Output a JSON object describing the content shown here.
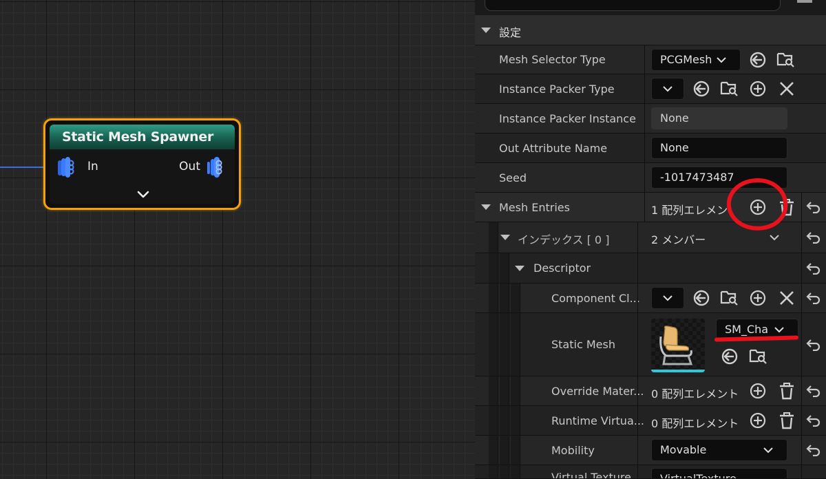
{
  "node": {
    "title": "Static Mesh Spawner",
    "input_pin": "In",
    "output_pin": "Out"
  },
  "panel": {
    "section_title": "設定",
    "mesh_selector_type": {
      "label": "Mesh Selector Type",
      "value": "PCGMesh"
    },
    "instance_packer_type": {
      "label": "Instance Packer Type",
      "value": ""
    },
    "instance_packer_instance": {
      "label": "Instance Packer Instance",
      "value": "None"
    },
    "out_attribute_name": {
      "label": "Out Attribute Name",
      "value": "None"
    },
    "seed": {
      "label": "Seed",
      "value": "-1017473487"
    },
    "mesh_entries": {
      "label": "Mesh Entries",
      "value": "1 配列エレメン"
    },
    "index0": {
      "label": "インデックス [ 0 ]",
      "value": "2 メンバー"
    },
    "descriptor": {
      "label": "Descriptor"
    },
    "component_class": {
      "label": "Component Cl...",
      "value": ""
    },
    "static_mesh": {
      "label": "Static Mesh",
      "value": "SM_Cha"
    },
    "override_materials": {
      "label": "Override Mater...",
      "value": "0 配列エレメント"
    },
    "runtime_virtual": {
      "label": "Runtime Virtua...",
      "value": "0 配列エレメント"
    },
    "mobility": {
      "label": "Mobility",
      "value": "Movable"
    },
    "virtual_texture": {
      "label": "Virtual Texture",
      "value": "VirtualTexture"
    }
  },
  "colors": {
    "node_border": "#f5a10c",
    "node_header": "#1f7a66",
    "pin_blue": "#3b7bff",
    "annotation_red": "#e8121d"
  }
}
